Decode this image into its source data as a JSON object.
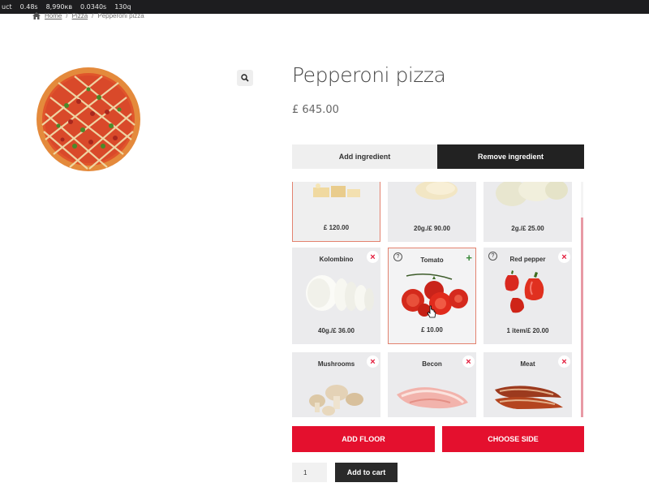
{
  "debugbar": {
    "items": [
      "uct",
      "0.48s",
      "8,990кв",
      "0.0340s",
      "130q"
    ]
  },
  "breadcrumb": {
    "home": "Home",
    "sep1": "/",
    "category": "Pizza",
    "sep2": "/",
    "current": "Pepperoni pizza"
  },
  "product": {
    "title": "Pepperoni pizza",
    "price": "£ 645.00"
  },
  "tabs": {
    "add": "Add ingredient",
    "remove": "Remove ingredient",
    "active": "remove"
  },
  "ingredients": [
    {
      "name": "",
      "price": "£ 120.00"
    },
    {
      "name": "",
      "price": "20g./£ 90.00"
    },
    {
      "name": "",
      "price": "2g./£ 25.00"
    },
    {
      "name": "Kolombino",
      "price": "40g./£ 36.00"
    },
    {
      "name": "Tomato",
      "price": "£ 10.00"
    },
    {
      "name": "Red pepper",
      "price": "1 item/£ 20.00"
    },
    {
      "name": "Mushrooms",
      "price": ""
    },
    {
      "name": "Becon",
      "price": ""
    },
    {
      "name": "Meat",
      "price": ""
    }
  ],
  "icons": {
    "remove": "×",
    "add": "+",
    "info": "?"
  },
  "buttons": {
    "add_floor": "ADD FLOOR",
    "choose_side": "CHOOSE SIDE",
    "add_to_cart": "Add to cart"
  },
  "quantity": {
    "value": "1"
  },
  "colors": {
    "accent_red": "#e4102e",
    "dark": "#222222",
    "selected_border": "#e3826f"
  }
}
